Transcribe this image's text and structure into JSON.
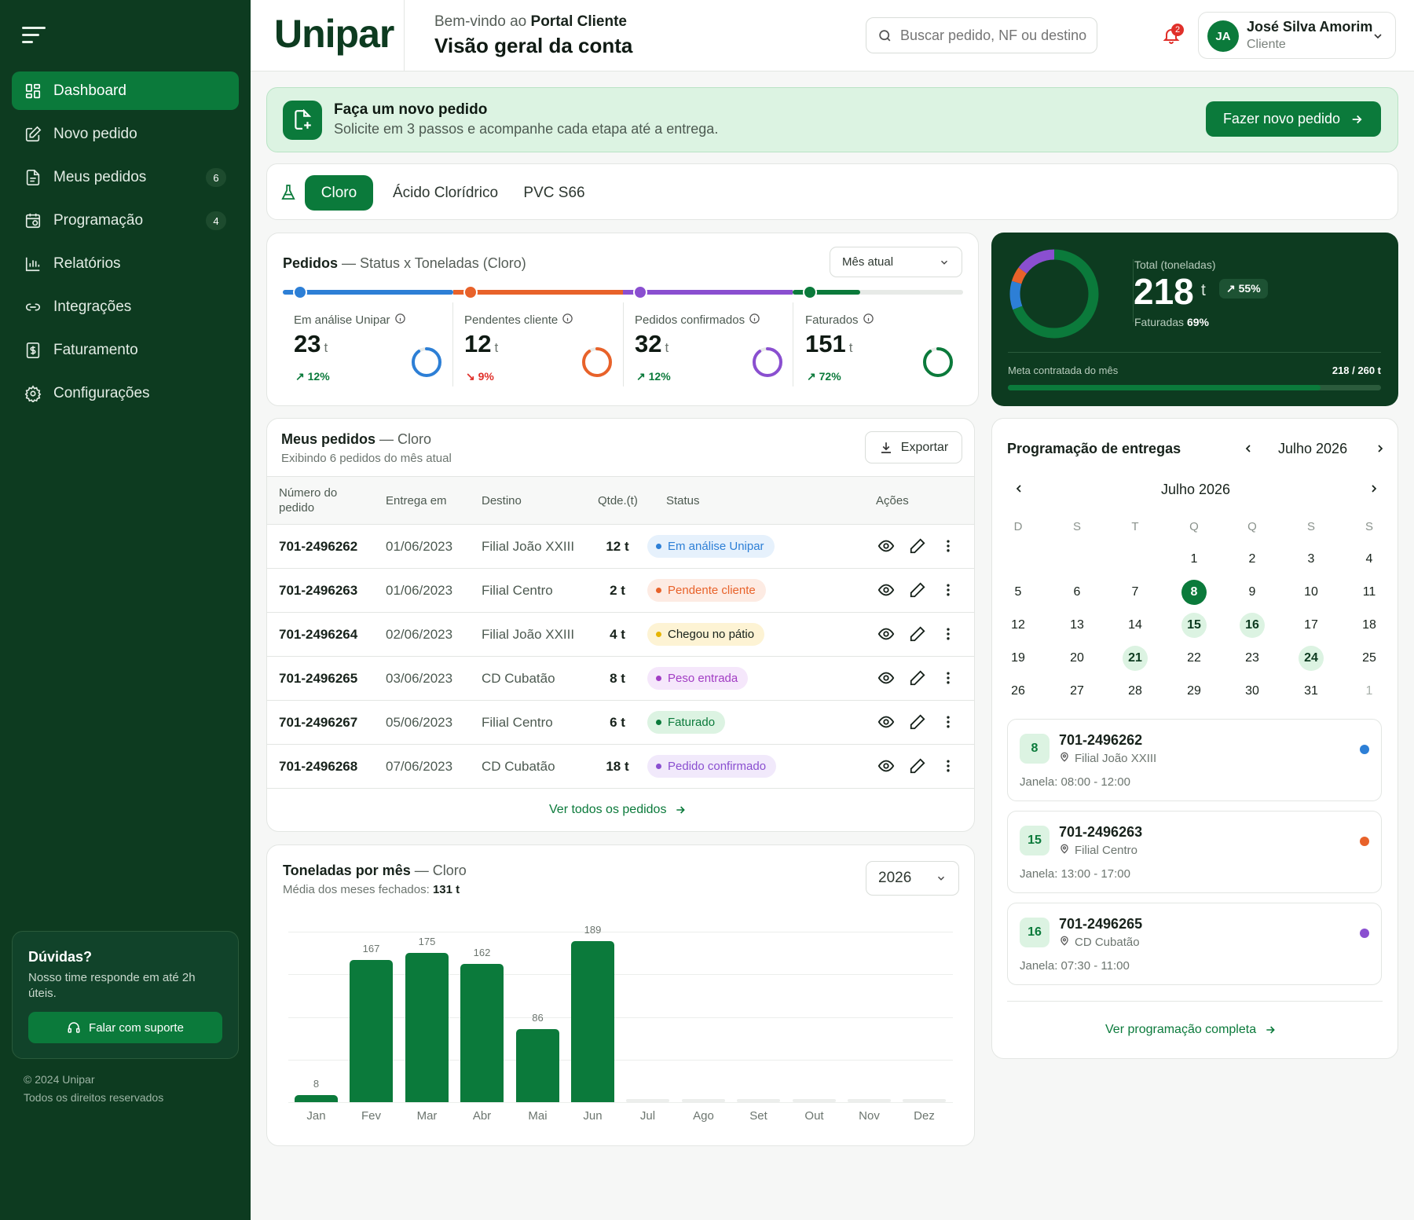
{
  "colors": {
    "brand": "#0b7a3b",
    "sidebar": "#0d3b20",
    "blue": "#2d7fd6",
    "orange": "#e8622a",
    "purple": "#8a4fd0",
    "green": "#0b7a3b"
  },
  "sidebar": {
    "items": [
      {
        "label": "Dashboard",
        "icon": "dashboard-icon",
        "badge": ""
      },
      {
        "label": "Novo pedido",
        "icon": "edit-icon",
        "badge": ""
      },
      {
        "label": "Meus pedidos",
        "icon": "document-icon",
        "badge": "6"
      },
      {
        "label": "Programação",
        "icon": "calendar-icon",
        "badge": "4"
      },
      {
        "label": "Relatórios",
        "icon": "bar-chart-icon",
        "badge": ""
      },
      {
        "label": "Integrações",
        "icon": "link-icon",
        "badge": ""
      },
      {
        "label": "Faturamento",
        "icon": "invoice-icon",
        "badge": ""
      },
      {
        "label": "Configurações",
        "icon": "gear-icon",
        "badge": ""
      }
    ],
    "help": {
      "title": "Dúvidas?",
      "text": "Nosso time responde em até 2h úteis.",
      "button": "Falar com suporte"
    },
    "copyright": "© 2024 Unipar",
    "rights": "Todos os direitos reservados"
  },
  "header": {
    "logo": "Unipar",
    "welcome_prefix": "Bem-vindo ao",
    "welcome_portal": "Portal Cliente",
    "title": "Visão geral da conta",
    "search_placeholder": "Buscar pedido, NF ou destino",
    "notifications": "2",
    "user_initials": "JA",
    "user_name": "José Silva Amorim",
    "user_role": "Cliente"
  },
  "banner": {
    "title": "Faça um novo pedido",
    "text": "Solicite em 3 passos e acompanhe cada etapa até a entrega.",
    "button": "Fazer novo pedido"
  },
  "tabs": [
    "Cloro",
    "Ácido Clorídrico",
    "PVC S66"
  ],
  "status_card": {
    "title": "Pedidos",
    "subtitle": "— Status x Toneladas (Cloro)",
    "period": "Mês atual",
    "stats": [
      {
        "label": "Em análise Unipar",
        "value": "23",
        "unit": "t",
        "trend": "↗ 12%",
        "dir": "up",
        "color": "#2d7fd6",
        "ring": 0.9
      },
      {
        "label": "Pendentes cliente",
        "value": "12",
        "unit": "t",
        "trend": "↘ 9%",
        "dir": "down",
        "color": "#e8622a",
        "ring": 0.9
      },
      {
        "label": "Pedidos confirmados",
        "value": "32",
        "unit": "t",
        "trend": "↗ 12%",
        "dir": "up",
        "color": "#8a4fd0",
        "ring": 0.9
      },
      {
        "label": "Faturados",
        "value": "151",
        "unit": "t",
        "trend": "↗ 72%",
        "dir": "up",
        "color": "#0b7a3b",
        "ring": 0.9
      }
    ]
  },
  "total_card": {
    "label": "Total (toneladas)",
    "value": "218",
    "unit": "t",
    "badge": "↗ 55%",
    "invoiced_label": "Faturadas",
    "invoiced_pct": "69%",
    "goal_label": "Meta contratada do mês",
    "goal_value": "218 / 260 t",
    "goal_fraction": 0.8385
  },
  "orders": {
    "title": "Meus pedidos",
    "subtitle": "— Cloro",
    "caption": "Exibindo 6 pedidos do mês atual",
    "export": "Exportar",
    "columns": [
      "Número do pedido",
      "Entrega em",
      "Destino",
      "Qtde.(t)",
      "Status",
      "Ações"
    ],
    "rows": [
      {
        "id": "701-2496262",
        "date": "01/06/2023",
        "dest": "Filial João XXIII",
        "qty": "12 t",
        "status": "Em análise Unipar",
        "fg": "#2d7fd6",
        "bg": "#e6f1fc"
      },
      {
        "id": "701-2496263",
        "date": "01/06/2023",
        "dest": "Filial Centro",
        "qty": "2 t",
        "status": "Pendente cliente",
        "fg": "#e8622a",
        "bg": "#fdebe3"
      },
      {
        "id": "701-2496264",
        "date": "02/06/2023",
        "dest": "Filial João XXIII",
        "qty": "4 t",
        "status": "Chegou no pátio",
        "fg": "#17221b",
        "bg": "#fdf3d4",
        "dot": "#e6b400"
      },
      {
        "id": "701-2496265",
        "date": "03/06/2023",
        "dest": "CD Cubatão",
        "qty": "8 t",
        "status": "Peso entrada",
        "fg": "#a23dc4",
        "bg": "#f5e7fb"
      },
      {
        "id": "701-2496267",
        "date": "05/06/2023",
        "dest": "Filial Centro",
        "qty": "6 t",
        "status": "Faturado",
        "fg": "#0b7a3b",
        "bg": "#dcf3e2"
      },
      {
        "id": "701-2496268",
        "date": "07/06/2023",
        "dest": "CD Cubatão",
        "qty": "18 t",
        "status": "Pedido confirmado",
        "fg": "#8a4fd0",
        "bg": "#f1e9fb"
      }
    ],
    "view_all": "Ver todos os pedidos"
  },
  "tons_chart": {
    "title": "Toneladas por mês",
    "subtitle": "— Cloro",
    "caption_prefix": "Média dos meses fechados:",
    "caption_value": "131 t",
    "year": "2026"
  },
  "chart_data": {
    "type": "bar",
    "categories": [
      "Jan",
      "Fev",
      "Mar",
      "Abr",
      "Mai",
      "Jun",
      "Jul",
      "Ago",
      "Set",
      "Out",
      "Nov",
      "Dez"
    ],
    "values": [
      8,
      167,
      175,
      162,
      86,
      189,
      null,
      null,
      null,
      null,
      null,
      null
    ],
    "ylim": [
      0,
      200
    ],
    "grid": true
  },
  "schedule": {
    "title": "Programação de entregas",
    "month": "Julho 2026",
    "cal_month": "Julho 2026",
    "weekdays": [
      "D",
      "S",
      "T",
      "Q",
      "Q",
      "S",
      "S"
    ],
    "weeks": [
      [
        "",
        "",
        "",
        "1",
        "2",
        "3",
        "4"
      ],
      [
        "5",
        "6",
        "7",
        "8",
        "9",
        "10",
        "11"
      ],
      [
        "12",
        "13",
        "14",
        "15",
        "16",
        "17",
        "18"
      ],
      [
        "19",
        "20",
        "21",
        "22",
        "23",
        "24",
        "25"
      ],
      [
        "26",
        "27",
        "28",
        "29",
        "30",
        "31",
        "1"
      ]
    ],
    "selected": "8",
    "marked": [
      "15",
      "16",
      "21",
      "24"
    ],
    "deliveries": [
      {
        "day": "8",
        "id": "701-2496262",
        "loc": "Filial João XXIII",
        "window": "Janela: 08:00 - 12:00",
        "color": "#2d7fd6"
      },
      {
        "day": "15",
        "id": "701-2496263",
        "loc": "Filial Centro",
        "window": "Janela: 13:00 - 17:00",
        "color": "#e8622a"
      },
      {
        "day": "16",
        "id": "701-2496265",
        "loc": "CD Cubatão",
        "window": "Janela: 07:30 - 11:00",
        "color": "#8a4fd0"
      }
    ],
    "view_all": "Ver programação completa"
  }
}
